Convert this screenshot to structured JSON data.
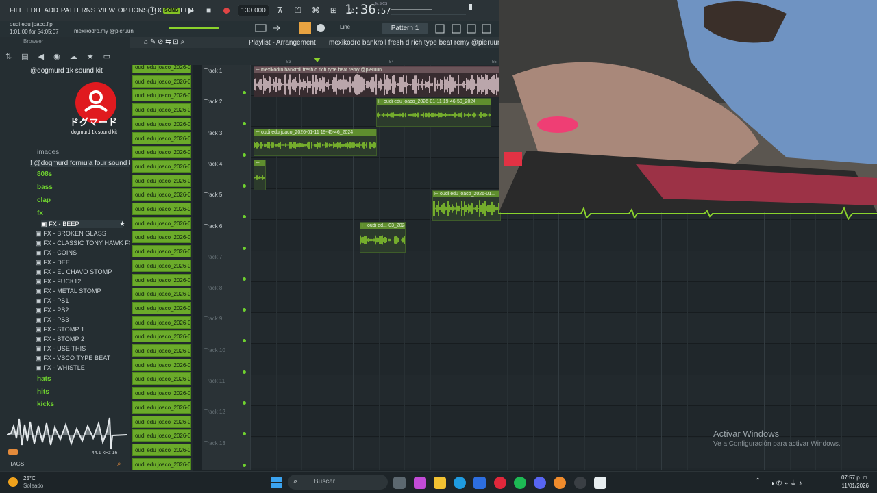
{
  "menu": [
    "FILE",
    "EDIT",
    "ADD",
    "PATTERNS",
    "VIEW",
    "OPTIONS",
    "TOOLS",
    "HELP"
  ],
  "transport": {
    "song_label": "SONG",
    "tempo": "130.000",
    "clock": "1:36",
    "clock_small": ":57",
    "mcs": "M:S:CS"
  },
  "hints": {
    "project": "oudi edu joaco.flp",
    "time": "1:01:00 for 54:05:07",
    "user": "mexikodro.my @pieruun"
  },
  "toolbar": {
    "snap": "Line",
    "pattern": "Pattern 1"
  },
  "playlist": {
    "title": "Playlist - Arrangement",
    "breadcrumb": "mexikodro  bankroll fresh  d rich type beat remy @pieruun",
    "markers": [
      "53",
      "54",
      "55"
    ]
  },
  "browser": {
    "header": "Browser",
    "top_folder": "@dogmurd 1k sound kit",
    "logo_text": "dogmurd 1k sound kit",
    "images": "images",
    "kit": "! @dogmurd formula four sound kit",
    "folders": [
      "808s",
      "bass",
      "clap",
      "fx"
    ],
    "fx_items": [
      "FX - BEEP",
      "FX - BROKEN GLASS",
      "FX - CLASSIC TONY HAWK FX",
      "FX - COINS",
      "FX - DEE",
      "FX - EL CHAVO STOMP",
      "FX - FUCK12",
      "FX - METAL STOMP",
      "FX - PS1",
      "FX - PS2",
      "FX - PS3",
      "FX - STOMP 1",
      "FX - STOMP 2",
      "FX - USE THIS",
      "FX - VSCO TYPE BEAT",
      "FX - WHISTLE"
    ],
    "folders2": [
      "hats",
      "hits",
      "kicks"
    ],
    "khz": "44.1 kHz 16",
    "tags": "TAGS"
  },
  "channel_label": "oudi edu joaco_2026-01...",
  "channel_count": 29,
  "tracks": [
    "Track 1",
    "Track 2",
    "Track 3",
    "Track 4",
    "Track 5",
    "Track 6",
    "Track 7",
    "Track 8",
    "Track 9",
    "Track 10",
    "Track 11",
    "Track 12",
    "Track 13"
  ],
  "clips": {
    "c1": "mexikodro  bankroll fresh  d rich type beat remy @pieruun",
    "c2": "oudi edu joaco_2026-01-11 19-46-50_2024",
    "c3": "oudi edu joaco_2026-01-11 19-45-46_2024",
    "c5": "oudi edu joaco_2026-01...",
    "c6": "oudi ed...-03_2024"
  },
  "watermark": {
    "title": "Activar Windows",
    "sub": "Ve a Configuración para activar Windows."
  },
  "taskbar": {
    "temp": "25°C",
    "cond": "Soleado",
    "search": "Buscar",
    "time": "07:57 p. m.",
    "date": "11/01/2026"
  },
  "colors": {
    "accent": "#6fd12f",
    "clip": "#5f8e2e",
    "record": "#e14545"
  }
}
